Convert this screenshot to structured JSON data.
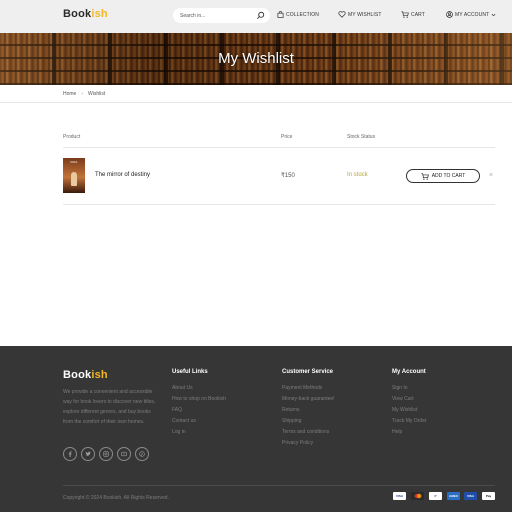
{
  "brand": {
    "part1": "Book",
    "part2": "ish"
  },
  "search": {
    "placeholder": "Search in..."
  },
  "nav": {
    "collection": "COLLECTION",
    "wishlist": "MY WISHLIST",
    "cart": "CART",
    "account": "MY ACCOUNT"
  },
  "banner": {
    "title": "My Wishlist"
  },
  "breadcrumb": {
    "home": "Home",
    "current": "Wishlist"
  },
  "table": {
    "headers": {
      "product": "Product",
      "price": "Price",
      "stock": "Stock Status"
    },
    "rows": [
      {
        "name": "The mirror of destiny",
        "cover_title": "SOUL",
        "price": "₹150",
        "stock": "In stock",
        "add_label": "ADD TO CART",
        "remove": "×"
      }
    ]
  },
  "footer": {
    "about": "We provide a convenient and accessible way for book lovers to discover new titles, explore different genres, and buy books from the comfort of their own homes.",
    "socials": [
      "facebook-icon",
      "twitter-icon",
      "instagram-icon",
      "youtube-icon",
      "pinterest-icon"
    ],
    "useful_links": {
      "title": "Useful Links",
      "items": [
        "About Us",
        "How to shop on Bookish",
        "FAQ",
        "Contact us",
        "Log in"
      ]
    },
    "customer_service": {
      "title": "Customer Service",
      "items": [
        "Payment Methods",
        "Money-back guarantee!",
        "Returns",
        "Shipping",
        "Terms and conditions",
        "Privacy Policy"
      ]
    },
    "my_account": {
      "title": "My Account",
      "items": [
        "Sign In",
        "View Cart",
        "My Wishlist",
        "Track My Order",
        "Help"
      ]
    },
    "copyright": "Copyright © 2024 Bookish. All Rights Reserved.",
    "payments": [
      {
        "name": "visa-icon",
        "label": "VISA",
        "color": "#1a3a8f"
      },
      {
        "name": "mastercard-icon",
        "label": "",
        "color": "#ffffff"
      },
      {
        "name": "paypal-icon",
        "label": "P",
        "color": "#ffffff"
      },
      {
        "name": "amex-icon",
        "label": "AMEX",
        "color": "#2b6fc2"
      },
      {
        "name": "visa-card-icon",
        "label": "VISA",
        "color": "#1f4fa8"
      },
      {
        "name": "applepay-icon",
        "label": "Pay",
        "color": "#ffffff"
      }
    ]
  },
  "colors": {
    "accent": "#f2b824",
    "stock": "#b5a43a",
    "footer_bg": "#363636"
  }
}
